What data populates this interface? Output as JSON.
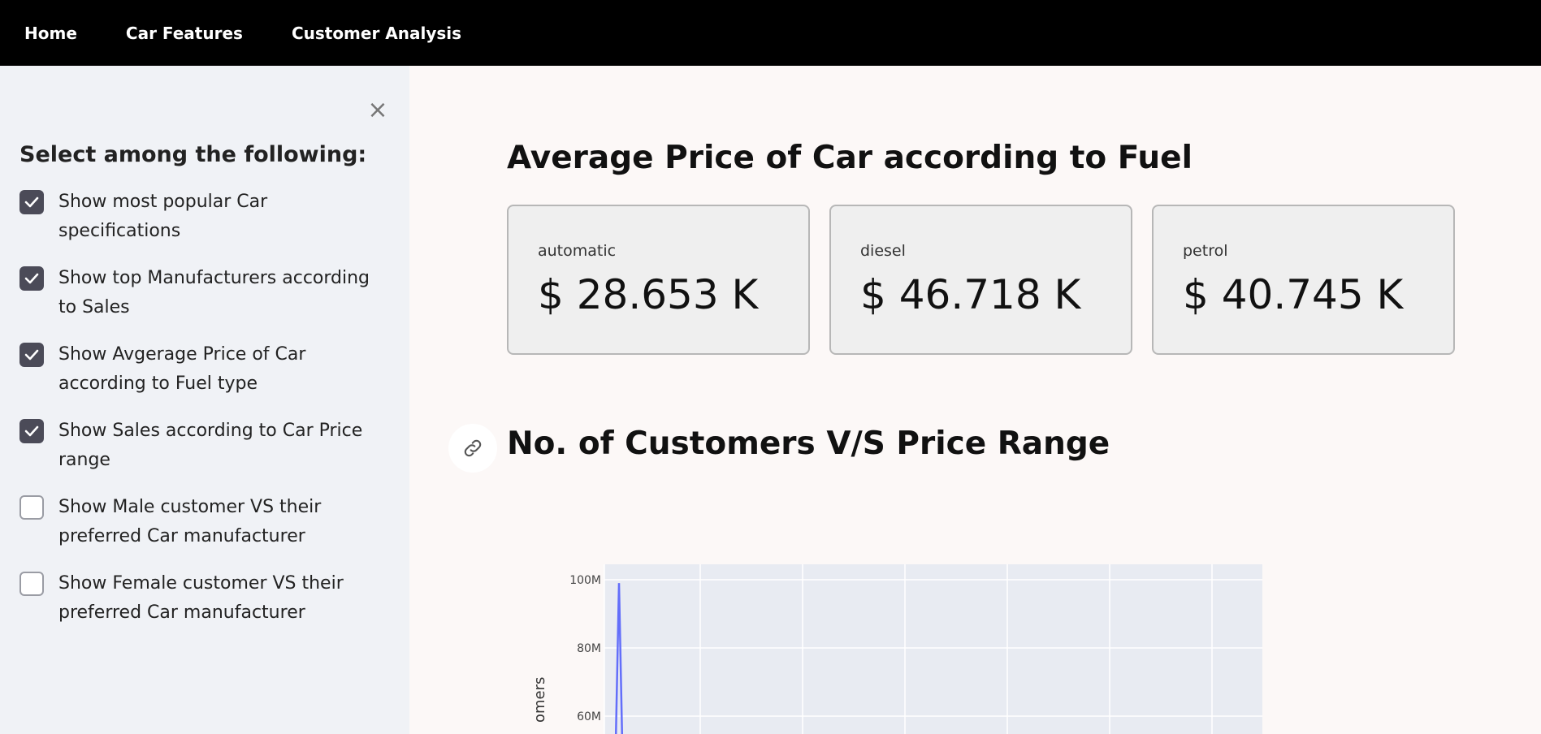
{
  "nav": {
    "items": [
      "Home",
      "Car Features",
      "Customer Analysis"
    ]
  },
  "sidebar": {
    "close_label": "×",
    "heading": "Select among the following:",
    "checkboxes": [
      {
        "label": "Show most popular Car specifications",
        "checked": true
      },
      {
        "label": "Show top Manufacturers according to Sales",
        "checked": true
      },
      {
        "label": "Show Avgerage Price of Car according to Fuel type",
        "checked": true
      },
      {
        "label": "Show Sales according to Car Price range",
        "checked": true
      },
      {
        "label": "Show Male customer VS their preferred Car manufacturer",
        "checked": false
      },
      {
        "label": "Show Female customer VS their preferred Car manufacturer",
        "checked": false
      }
    ]
  },
  "main": {
    "title": "Average Price of Car according to Fuel",
    "metrics": [
      {
        "label": "automatic",
        "value": "$ 28.653 K"
      },
      {
        "label": "diesel",
        "value": "$ 46.718 K"
      },
      {
        "label": "petrol",
        "value": "$ 40.745 K"
      }
    ],
    "section_title": "No. of Customers V/S Price Range"
  },
  "chart_data": {
    "type": "line",
    "title": "",
    "ylabel": "omers",
    "yticks": [
      "100M",
      "80M",
      "60M"
    ],
    "ylim_visible": [
      55000000,
      105000000
    ],
    "series": [
      {
        "color": "#636efa",
        "points": [
          [
            0,
            52000000
          ],
          [
            1,
            99000000
          ],
          [
            2,
            52000000
          ]
        ]
      }
    ],
    "grid": true
  },
  "colors": {
    "nav_bg": "#000000",
    "sidebar_bg": "#f0f2f6",
    "checkbox_checked": "#4b4b58",
    "line": "#636efa"
  }
}
